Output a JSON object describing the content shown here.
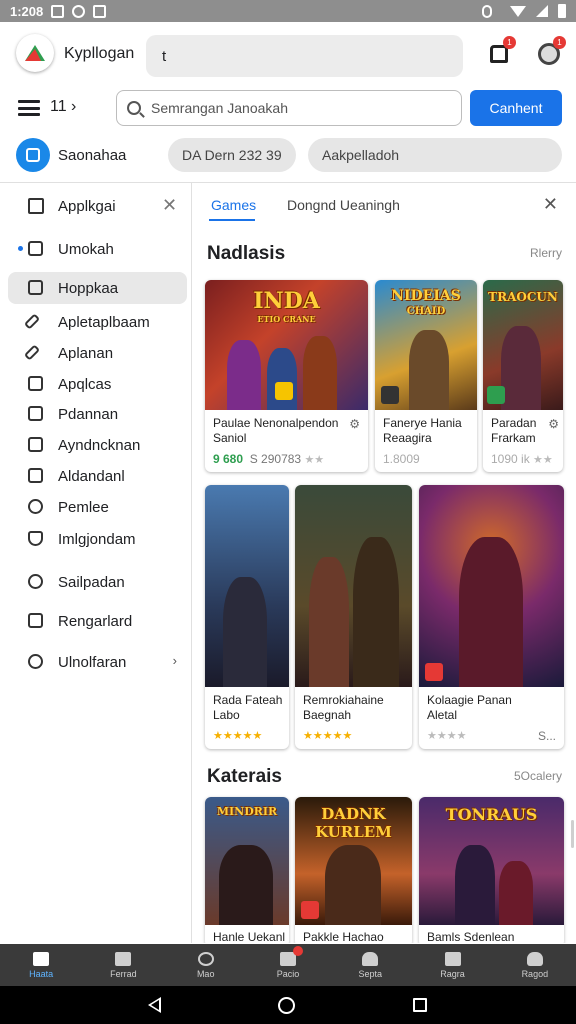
{
  "status_bar": {
    "time": "1:208",
    "icons": [
      "image-icon",
      "sync-icon",
      "notification-icon",
      "vibrate-icon",
      "wifi-icon",
      "signal-icon",
      "battery-icon"
    ]
  },
  "header": {
    "app_name": "Kypllogan",
    "search_value": "t",
    "notification_badge": "1",
    "profile_badge": "1",
    "crumb": "11 ›",
    "search_placeholder": "Semrangan Janoakah",
    "search_button": "Canhent",
    "account_name": "Saonahaa",
    "chips": [
      "DA Dern 232 39",
      "Aakpelladoh"
    ]
  },
  "sidebar": {
    "header": "Applkgai",
    "items": [
      {
        "label": "Umokah",
        "icon": "store-icon"
      },
      {
        "label": "Hoppkaa",
        "icon": "window-icon"
      },
      {
        "label": "Apletaplbaam",
        "icon": "pencil-icon"
      },
      {
        "label": "Aplanan",
        "icon": "pencil-icon"
      },
      {
        "label": "Apqlcas",
        "icon": "square-icon"
      },
      {
        "label": "Pdannan",
        "icon": "box-icon"
      },
      {
        "label": "Ayndncknan",
        "icon": "edit-icon"
      },
      {
        "label": "Aldandanl",
        "icon": "list-icon"
      },
      {
        "label": "Pemlee",
        "icon": "info-icon"
      },
      {
        "label": "Imlgjondam",
        "icon": "shield-icon"
      },
      {
        "label": "Sailpadan",
        "icon": "gamepad-icon"
      },
      {
        "label": "Rengarlard",
        "icon": "bag-icon"
      },
      {
        "label": "Ulnolfaran",
        "icon": "emoji-icon"
      }
    ]
  },
  "tabs": {
    "active": "Games",
    "other": "Dongnd Ueaningh"
  },
  "sections": [
    {
      "title": "Nadlasis",
      "more": "Rlerry",
      "cards": [
        {
          "art_title": "INDA",
          "art_subtitle": "ETIO CRANE",
          "name_line1": "Paulae Nenonalpendon",
          "name_line2": "Saniol",
          "rating_green": "9 680",
          "price": "S 290783",
          "stars": "★★"
        },
        {
          "art_title": "NIDEIAS",
          "art_subtitle": "CHAID",
          "name_line1": "Fanerye Hania",
          "name_line2": "Reaagira",
          "meta": "1.8009"
        },
        {
          "art_title": "TRAOCUN",
          "art_subtitle": "",
          "name_line1": "Paradan",
          "name_line2": "Frarkam",
          "meta": "1090 ik",
          "stars": "★★"
        }
      ]
    },
    {
      "title": "",
      "more": "",
      "cards": [
        {
          "name_line1": "Rada Fateah",
          "name_line2": "Labo",
          "stars": "★★★★★"
        },
        {
          "name_line1": "Remrokiahaine",
          "name_line2": "Baegnah",
          "stars": "★★★★★"
        },
        {
          "name_line1": "Kolaagie Panan",
          "name_line2": "Aletal",
          "stars": "★★★★",
          "meta": "S..."
        }
      ]
    },
    {
      "title": "Katerais",
      "more": "5Ocalery",
      "cards": [
        {
          "art_title": "MINDRIR",
          "art_subtitle": "",
          "name_line1": "Hanle Uekanl"
        },
        {
          "art_title": "DADNK KURLEM",
          "art_subtitle": "",
          "name_line1": "Pakkle Hachao"
        },
        {
          "art_title": "TONRAUS",
          "art_subtitle": "",
          "name_line1": "Bamls Sdenlean"
        }
      ]
    }
  ],
  "bottom_nav": [
    {
      "label": "Haata",
      "icon": "home-icon"
    },
    {
      "label": "Ferrad",
      "icon": "library-icon"
    },
    {
      "label": "Mao",
      "icon": "chat-icon"
    },
    {
      "label": "Pacio",
      "icon": "house-icon"
    },
    {
      "label": "Septa",
      "icon": "cloud-icon"
    },
    {
      "label": "Ragra",
      "icon": "document-icon"
    },
    {
      "label": "Ragod",
      "icon": "person-icon"
    }
  ],
  "colors": {
    "accent": "#1a73e8",
    "badge": "#e53935",
    "nav_bg": "#3a3a3a",
    "status_bg": "#8e8e8e",
    "rating_green": "#2e9e4f",
    "star_gold": "#f6b000"
  }
}
